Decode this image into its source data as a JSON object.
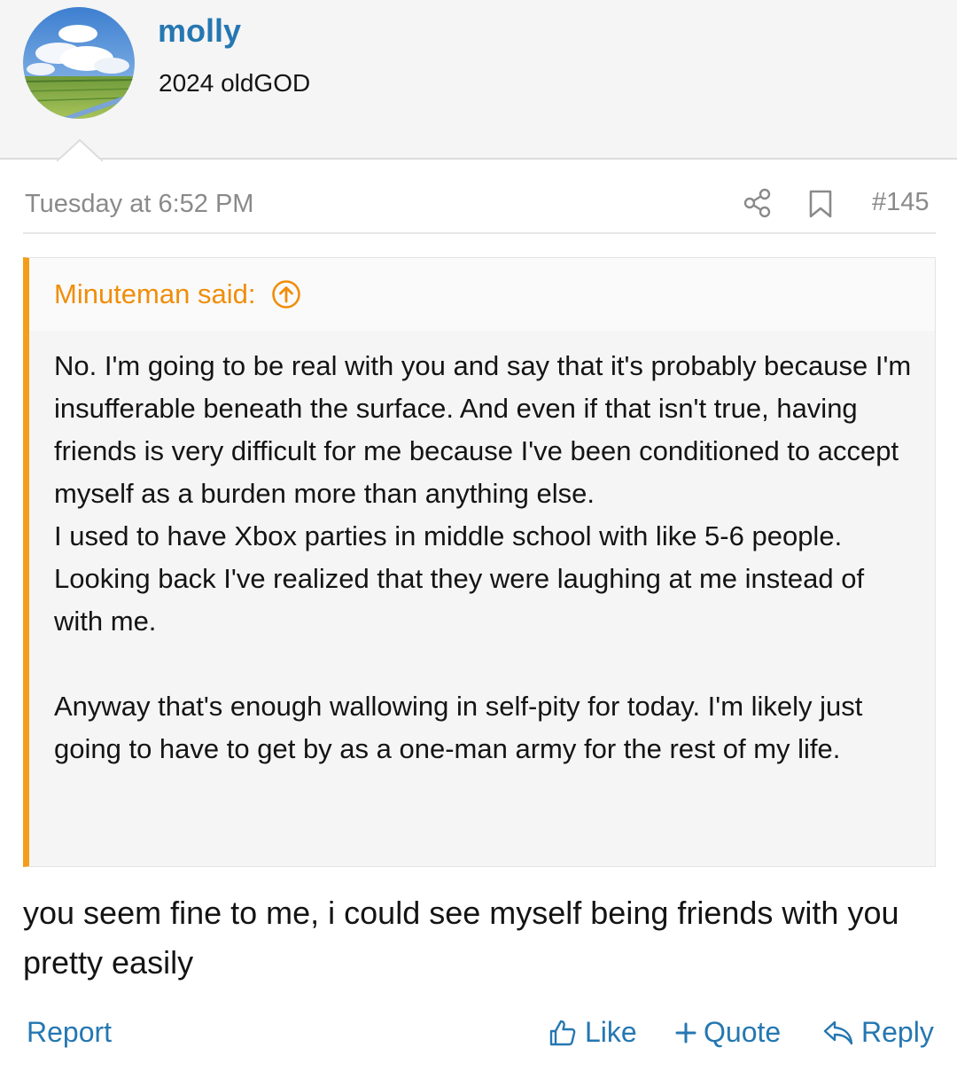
{
  "user": {
    "name": "molly",
    "title": "2024 oldGOD",
    "avatar_icon": "avatar-sky-field"
  },
  "post": {
    "date": "Tuesday at 6:52 PM",
    "number": "#145",
    "share_icon": "share-icon",
    "bookmark_icon": "bookmark-icon",
    "body": "you seem fine to me, i could see myself being friends with you pretty easily"
  },
  "quote": {
    "author": "Minuteman said:",
    "paragraph1": "No. I'm going to be real with you and say that it's probably because I'm insufferable beneath the surface. And even if that isn't true, having friends is very difficult for me because I've been conditioned to accept myself as a burden more than anything else.",
    "paragraph2": "I used to have Xbox parties in middle school with like 5-6 people. Looking back I've realized that they were laughing at me instead of with me.",
    "paragraph3": "Anyway that's enough wallowing in self-pity for today. I'm likely just going to have to get by as a one-man army for the rest of my life."
  },
  "actions": {
    "report": "Report",
    "like": "Like",
    "quote": "Quote",
    "reply": "Reply"
  },
  "colors": {
    "link": "#2577b1",
    "quote_accent": "#f49d1a",
    "muted": "#8a8a8a"
  }
}
